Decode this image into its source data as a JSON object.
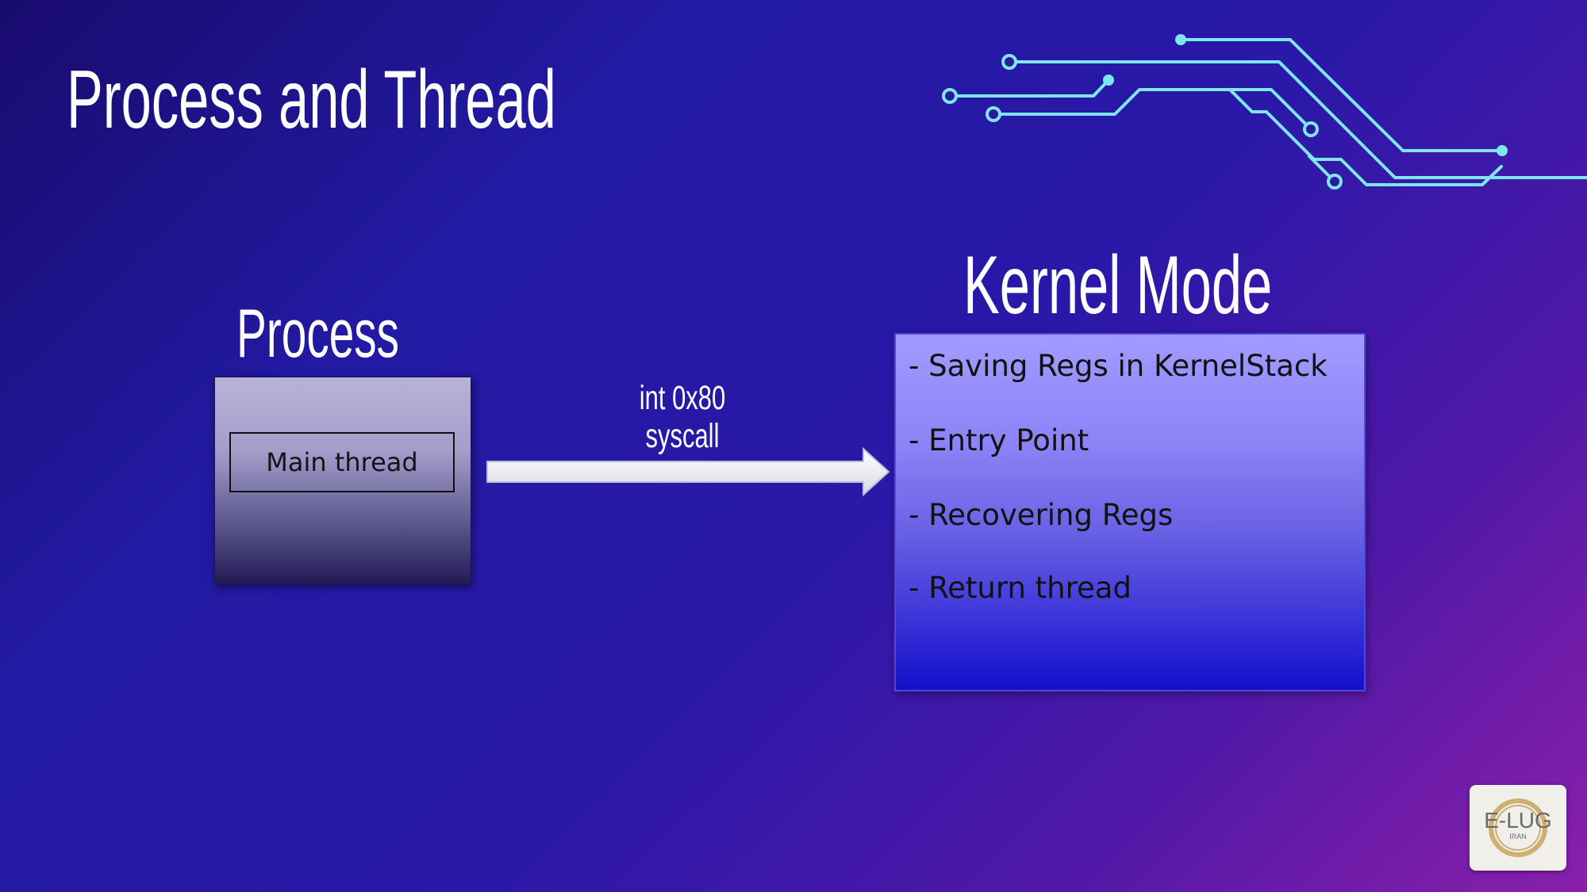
{
  "slide": {
    "title": "Process and Thread"
  },
  "process": {
    "title": "Process",
    "main_thread_label": "Main thread"
  },
  "syscall": {
    "line1": "int 0x80",
    "line2": "syscall"
  },
  "kernel": {
    "title": "Kernel Mode",
    "items": [
      "- Saving Regs in KernelStack",
      "- Entry Point",
      "- Recovering Regs",
      "- Return thread"
    ]
  },
  "logo": {
    "text": "E-LUG",
    "subtext": "IRAN"
  },
  "colors": {
    "circuit": "#7fe6f0",
    "kernel_box_top": "#a19bff",
    "kernel_box_bottom": "#1210c9",
    "arrow_fill": "#ffffff"
  },
  "icons": {
    "decoration": "circuit-lines-icon",
    "arrow": "right-arrow-icon",
    "logo": "elug-logo-icon"
  }
}
